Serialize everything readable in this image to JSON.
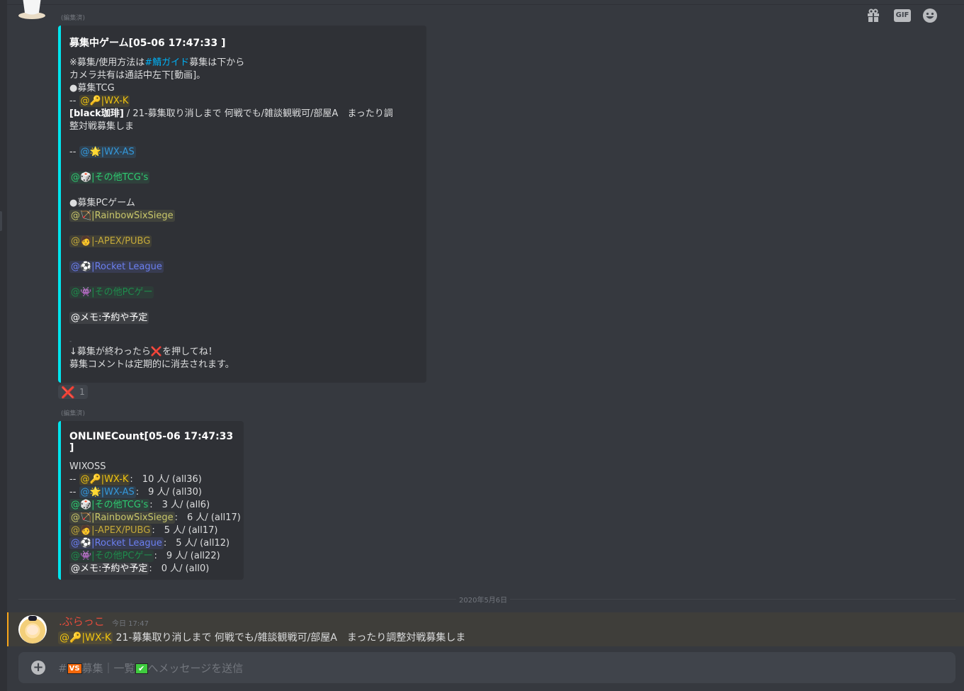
{
  "message_top": {
    "edited_label": "(編集済)",
    "embed": {
      "title": "募集中ゲーム[05-06 17:47:33 ]",
      "accent_color": "#00e5ee",
      "intro_prefix": "※募集/使用方法は",
      "intro_link": "#鯖ガイド",
      "intro_suffix": "募集は下から",
      "camera_line": "カメラ共有は通話中左下[動画]。",
      "section_tcg": "●募集TCG",
      "dash": "-- ",
      "mention_wxk": "@🔑|WX-K",
      "post_author": "[black珈琲]",
      "post_text_1": " / 21-募集取り消しまで 何戦でも/雑談観戦可/部屋A　まったり調",
      "post_text_2": "整対戦募集しま",
      "mention_wxas": "@🌟|WX-AS",
      "mention_other_tcg": "@🎲|その他TCG's",
      "section_pc": "●募集PCゲーム",
      "mention_r6": "@🏹|RainbowSixSiege",
      "mention_apex": "@🧑|-APEX/PUBG",
      "mention_rl": "@⚽|Rocket League",
      "mention_other_pc": "@👾|その他PCゲー",
      "mention_memo": "@メモ:予約や予定",
      "dash_small": "-",
      "footer_1": "↓募集が終わったら❌を押してね！",
      "footer_2": "募集コメントは定期的に消去されます。"
    },
    "reaction": {
      "emoji": "❌",
      "count": "1"
    }
  },
  "message_count": {
    "edited_label": "(編集済)",
    "embed": {
      "title": "ONLINECount[05-06 17:47:33 ]",
      "game": "WIXOSS",
      "rows": [
        {
          "prefix": "-- ",
          "mention": "@🔑|WX-K",
          "count": ":　10 人/ (all36)"
        },
        {
          "prefix": "-- ",
          "mention": "@🌟|WX-AS",
          "count": ":　9 人/ (all30)"
        },
        {
          "prefix": "",
          "mention": "@🎲|その他TCG's",
          "count": ":　3 人/ (all6)"
        },
        {
          "prefix": "",
          "mention": "@🏹|RainbowSixSiege",
          "count": ":　6 人/ (all17)"
        },
        {
          "prefix": "",
          "mention": "@🧑|-APEX/PUBG",
          "count": ":　5 人/ (all17)"
        },
        {
          "prefix": "",
          "mention": "@⚽|Rocket League",
          "count": ":　5 人/ (all12)"
        },
        {
          "prefix": "",
          "mention": "@👾|その他PCゲー",
          "count": ":　9 人/ (all22)"
        },
        {
          "prefix": "",
          "mention": "@メモ:予約や予定",
          "count": ":　0 人/ (all0)"
        }
      ]
    }
  },
  "date_divider": "2020年5月6日",
  "message_user": {
    "author": ".ぶらっこ",
    "timestamp": "今日 17:47",
    "mention": "@🔑|WX-K",
    "text": " 21-募集取り消しまで 何戦でも/雑談観戦可/部屋A　まったり調整対戦募集しま"
  },
  "composer": {
    "placeholder_prefix": "#",
    "channel_badge": "VS",
    "placeholder_mid": "募集｜一覧",
    "check_badge": "✔",
    "placeholder_suffix": "へメッセージを送信",
    "gif_label": "GIF"
  },
  "icons": {
    "add": "plus-circle-icon",
    "gift": "gift-icon",
    "gif": "gif-icon",
    "emoji": "smile-emoji-icon"
  }
}
